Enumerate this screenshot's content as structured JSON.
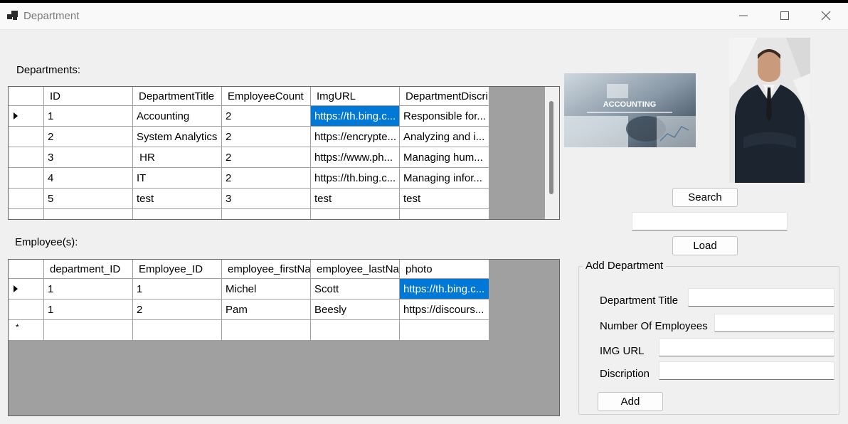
{
  "window": {
    "title": "Department"
  },
  "labels": {
    "departments": "Departments:",
    "employees": "Employee(s):"
  },
  "departments_grid": {
    "columns": [
      "ID",
      "DepartmentTitle",
      "EmployeeCount",
      "ImgURL",
      "DepartmentDiscri"
    ],
    "rows": [
      [
        "1",
        "Accounting",
        "2",
        "https://th.bing.c...",
        "Responsible for..."
      ],
      [
        "2",
        "System Analytics",
        "2",
        "https://encrypte...",
        "Analyzing and i..."
      ],
      [
        "3",
        " HR",
        "2",
        "https://www.ph...",
        "Managing hum..."
      ],
      [
        "4",
        "IT",
        "2",
        "https://th.bing.c...",
        "Managing infor..."
      ],
      [
        "5",
        "test",
        "3",
        "test",
        "test"
      ]
    ]
  },
  "employees_grid": {
    "columns": [
      "department_ID",
      "Employee_ID",
      "employee_firstNa",
      "employee_lastNa",
      "photo"
    ],
    "rows": [
      [
        "1",
        "1",
        "Michel",
        "Scott",
        "https://th.bing.c..."
      ],
      [
        "1",
        "2",
        "Pam",
        "Beesly",
        "https://discours..."
      ]
    ],
    "new_row_marker": "*"
  },
  "images": {
    "accounting_banner_text": "ACCOUNTING"
  },
  "buttons": {
    "search": "Search",
    "load": "Load",
    "add": "Add"
  },
  "search_input": {
    "value": ""
  },
  "add_department": {
    "title": "Add Department",
    "fields": {
      "department_title": {
        "label": "Department Title",
        "value": ""
      },
      "num_employees": {
        "label": "Number Of Employees",
        "value": ""
      },
      "img_url": {
        "label": "IMG URL",
        "value": ""
      },
      "discription": {
        "label": "Discription",
        "value": ""
      }
    }
  },
  "colors": {
    "selection": "#0078d7",
    "grid_background": "#a0a0a0",
    "window": "#f0f0f0"
  }
}
